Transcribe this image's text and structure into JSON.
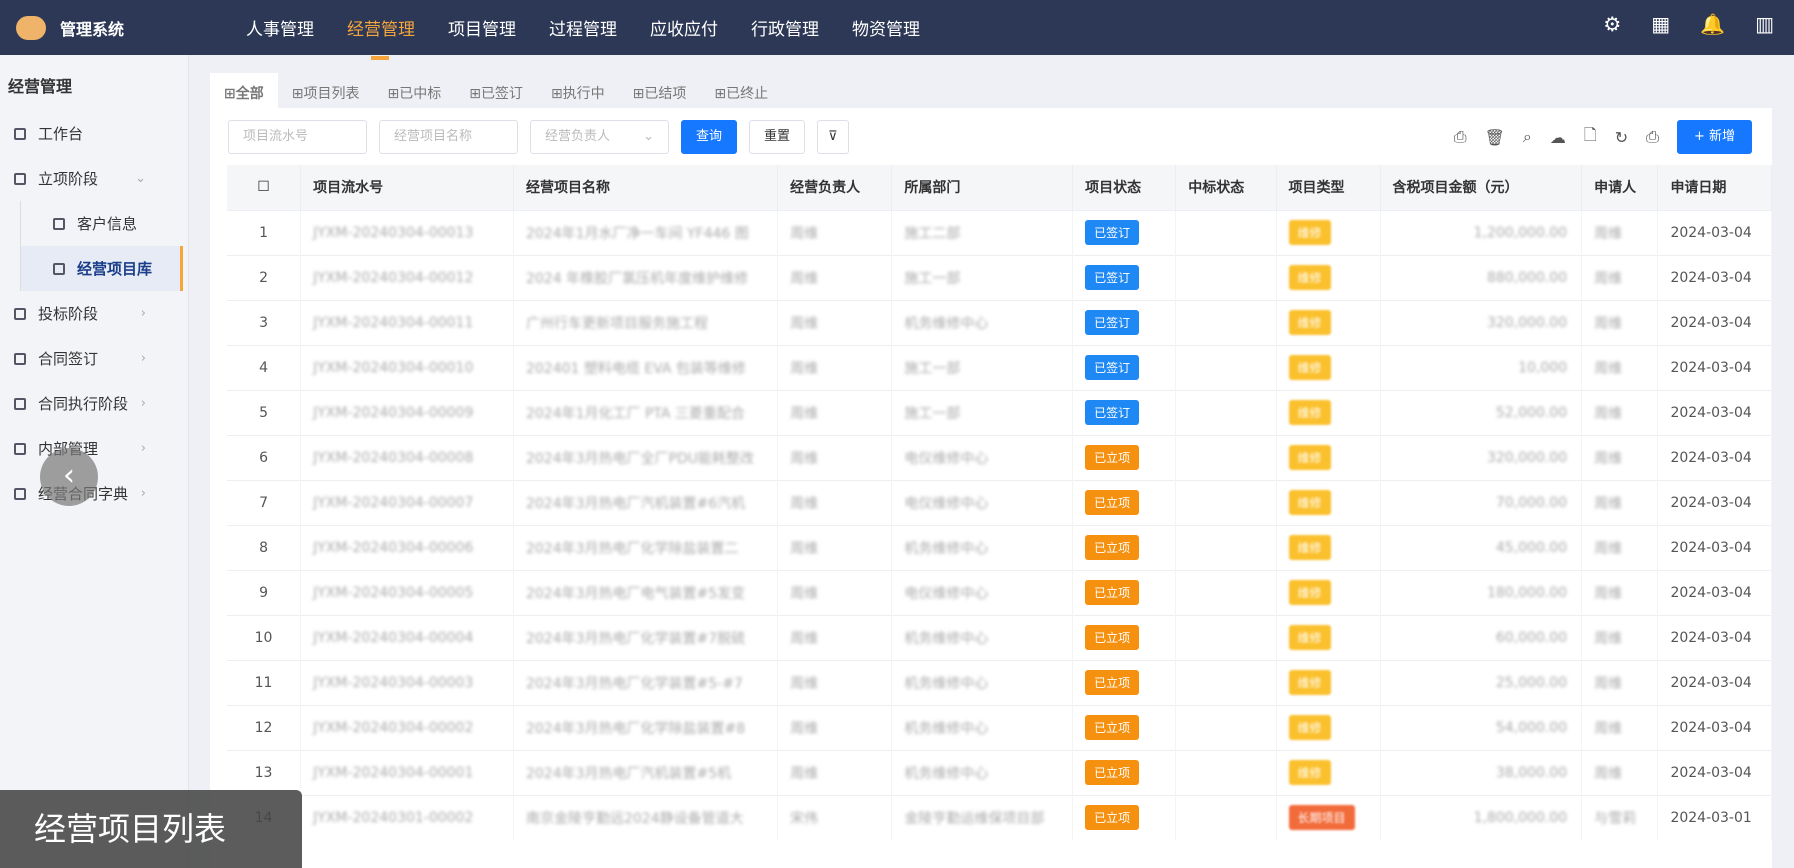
{
  "app": {
    "title": "管理系统"
  },
  "nav": [
    "人事管理",
    "经营管理",
    "项目管理",
    "过程管理",
    "应收应付",
    "行政管理",
    "物资管理"
  ],
  "sidebar": {
    "title": "经营管理",
    "items": [
      {
        "label": "工作台"
      },
      {
        "label": "立项阶段",
        "chev": "⌄"
      },
      {
        "label": "客户信息",
        "sub": true
      },
      {
        "label": "经营项目库",
        "sub": true,
        "active": true
      },
      {
        "label": "投标阶段",
        "chev": "›"
      },
      {
        "label": "合同签订",
        "chev": "›"
      },
      {
        "label": "合同执行阶段",
        "chev": "›"
      },
      {
        "label": "内部管理",
        "chev": "›"
      },
      {
        "label": "经营合同字典",
        "chev": "›"
      }
    ]
  },
  "tabs": [
    "全部",
    "项目列表",
    "已中标",
    "已签订",
    "执行中",
    "已结项",
    "已终止"
  ],
  "filters": {
    "serial_placeholder": "项目流水号",
    "name_placeholder": "经营项目名称",
    "owner_placeholder": "经营负责人",
    "query": "查询",
    "reset": "重置",
    "filter": "⊽",
    "add": "+ 新增"
  },
  "columns": [
    "项目流水号",
    "经营项目名称",
    "经营负责人",
    "所属部门",
    "项目状态",
    "中标状态",
    "项目类型",
    "含税项目金额（元）",
    "申请人",
    "申请日期"
  ],
  "rows": [
    {
      "n": "1",
      "id": "JYXM-20240304-00013",
      "name": "2024年1月水厂净一车间 YF446 图",
      "owner": "周维",
      "dept": "施工二部",
      "status": "已签订",
      "sc": "b",
      "type": "维修",
      "tc": "y",
      "amt": "1,200,000.00",
      "app": "周维",
      "date": "2024-03-04"
    },
    {
      "n": "2",
      "id": "JYXM-20240304-00012",
      "name": "2024 年橡胶厂氯压机年度维护维修",
      "owner": "周维",
      "dept": "施工一部",
      "status": "已签订",
      "sc": "b",
      "type": "维修",
      "tc": "y",
      "amt": "880,000.00",
      "app": "周维",
      "date": "2024-03-04"
    },
    {
      "n": "3",
      "id": "JYXM-20240304-00011",
      "name": "广州行车更新项目服务施工程",
      "owner": "周维",
      "dept": "机务维修中心",
      "status": "已签订",
      "sc": "b",
      "type": "维修",
      "tc": "y",
      "amt": "320,000.00",
      "app": "周维",
      "date": "2024-03-04"
    },
    {
      "n": "4",
      "id": "JYXM-20240304-00010",
      "name": "202401 塑料电缆 EVA 包装等维修",
      "owner": "周维",
      "dept": "施工一部",
      "status": "已签订",
      "sc": "b",
      "type": "维修",
      "tc": "y",
      "amt": "10,000",
      "app": "周维",
      "date": "2024-03-04"
    },
    {
      "n": "5",
      "id": "JYXM-20240304-00009",
      "name": "2024年1月化工厂 PTA 三菱重配合",
      "owner": "周维",
      "dept": "施工一部",
      "status": "已签订",
      "sc": "b",
      "type": "维修",
      "tc": "y",
      "amt": "52,000.00",
      "app": "周维",
      "date": "2024-03-04"
    },
    {
      "n": "6",
      "id": "JYXM-20240304-00008",
      "name": "2024年3月热电厂全厂PDU能耗整改",
      "owner": "周维",
      "dept": "电仪维修中心",
      "status": "已立项",
      "sc": "o",
      "type": "维修",
      "tc": "y",
      "amt": "320,000.00",
      "app": "周维",
      "date": "2024-03-04"
    },
    {
      "n": "7",
      "id": "JYXM-20240304-00007",
      "name": "2024年3月热电厂汽机装置#6汽机",
      "owner": "周维",
      "dept": "电仪维修中心",
      "status": "已立项",
      "sc": "o",
      "type": "维修",
      "tc": "y",
      "amt": "70,000.00",
      "app": "周维",
      "date": "2024-03-04"
    },
    {
      "n": "8",
      "id": "JYXM-20240304-00006",
      "name": "2024年3月热电厂化学除盐装置二",
      "owner": "周维",
      "dept": "机务维修中心",
      "status": "已立项",
      "sc": "o",
      "type": "维修",
      "tc": "y",
      "amt": "45,000.00",
      "app": "周维",
      "date": "2024-03-04"
    },
    {
      "n": "9",
      "id": "JYXM-20240304-00005",
      "name": "2024年3月热电厂电气装置#5发变",
      "owner": "周维",
      "dept": "电仪维修中心",
      "status": "已立项",
      "sc": "o",
      "type": "维修",
      "tc": "y",
      "amt": "180,000.00",
      "app": "周维",
      "date": "2024-03-04"
    },
    {
      "n": "10",
      "id": "JYXM-20240304-00004",
      "name": "2024年3月热电厂化学装置#7脱硫",
      "owner": "周维",
      "dept": "机务维修中心",
      "status": "已立项",
      "sc": "o",
      "type": "维修",
      "tc": "y",
      "amt": "60,000.00",
      "app": "周维",
      "date": "2024-03-04"
    },
    {
      "n": "11",
      "id": "JYXM-20240304-00003",
      "name": "2024年3月热电厂化学装置#5-#7",
      "owner": "周维",
      "dept": "机务维修中心",
      "status": "已立项",
      "sc": "o",
      "type": "维修",
      "tc": "y",
      "amt": "25,000.00",
      "app": "周维",
      "date": "2024-03-04"
    },
    {
      "n": "12",
      "id": "JYXM-20240304-00002",
      "name": "2024年3月热电厂化学除盐装置#8",
      "owner": "周维",
      "dept": "机务维修中心",
      "status": "已立项",
      "sc": "o",
      "type": "维修",
      "tc": "y",
      "amt": "54,000.00",
      "app": "周维",
      "date": "2024-03-04"
    },
    {
      "n": "13",
      "id": "JYXM-20240304-00001",
      "name": "2024年3月热电厂汽机装置#5机",
      "owner": "周维",
      "dept": "机务维修中心",
      "status": "已立项",
      "sc": "o",
      "type": "维修",
      "tc": "y",
      "amt": "38,000.00",
      "app": "周维",
      "date": "2024-03-04"
    },
    {
      "n": "14",
      "id": "JYXM-20240301-00002",
      "name": "南京金陵亨勤远2024静设备管道大",
      "owner": "宋伟",
      "dept": "金陵亨勤运维保项目部",
      "status": "已立项",
      "sc": "o",
      "type": "长期项目",
      "tc": "r",
      "amt": "1,800,000.00",
      "app": "与雪莉",
      "date": "2024-03-01"
    }
  ],
  "caption": "经营项目列表"
}
